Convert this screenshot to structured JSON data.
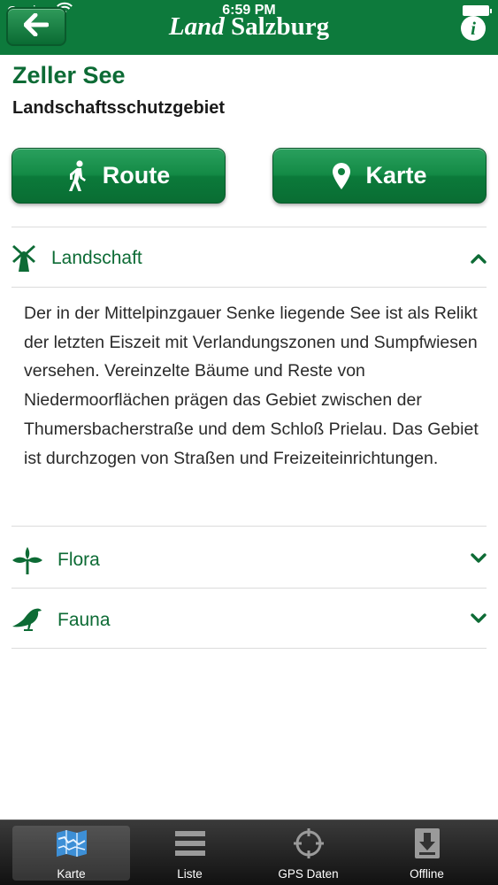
{
  "status_bar": {
    "carrier": "Carrier",
    "time": "6:59 PM"
  },
  "header": {
    "logo_land": "Land",
    "logo_salzburg": "Salzburg",
    "back_icon": "arrow-left-icon",
    "info_label": "i"
  },
  "page": {
    "title": "Zeller See",
    "subtitle": "Landschaftsschutzgebiet"
  },
  "actions": {
    "route_label": "Route",
    "karte_label": "Karte"
  },
  "sections": [
    {
      "label": "Landschaft",
      "icon": "windmill-icon",
      "expanded": true,
      "body": "Der in der Mittelpinzgauer Senke liegende See ist als Relikt der letzten Eiszeit mit Verlandungszonen und Sumpfwiesen versehen. Vereinzelte Bäume und Reste von Niedermoorflächen prägen das Gebiet zwischen der Thumersbacherstraße und dem Schloß Prielau. Das Gebiet ist durchzogen von Straßen und Freizeiteinrichtungen."
    },
    {
      "label": "Flora",
      "icon": "plant-icon",
      "expanded": false
    },
    {
      "label": "Fauna",
      "icon": "bird-icon",
      "expanded": false
    }
  ],
  "tabs": [
    {
      "label": "Karte",
      "icon": "map-icon",
      "active": true
    },
    {
      "label": "Liste",
      "icon": "list-icon",
      "active": false
    },
    {
      "label": "GPS Daten",
      "icon": "crosshair-icon",
      "active": false
    },
    {
      "label": "Offline",
      "icon": "download-icon",
      "active": false
    }
  ],
  "colors": {
    "brand_green": "#0d7a3c",
    "title_green": "#0d6b35",
    "tab_bar": "#1a1a1a"
  }
}
